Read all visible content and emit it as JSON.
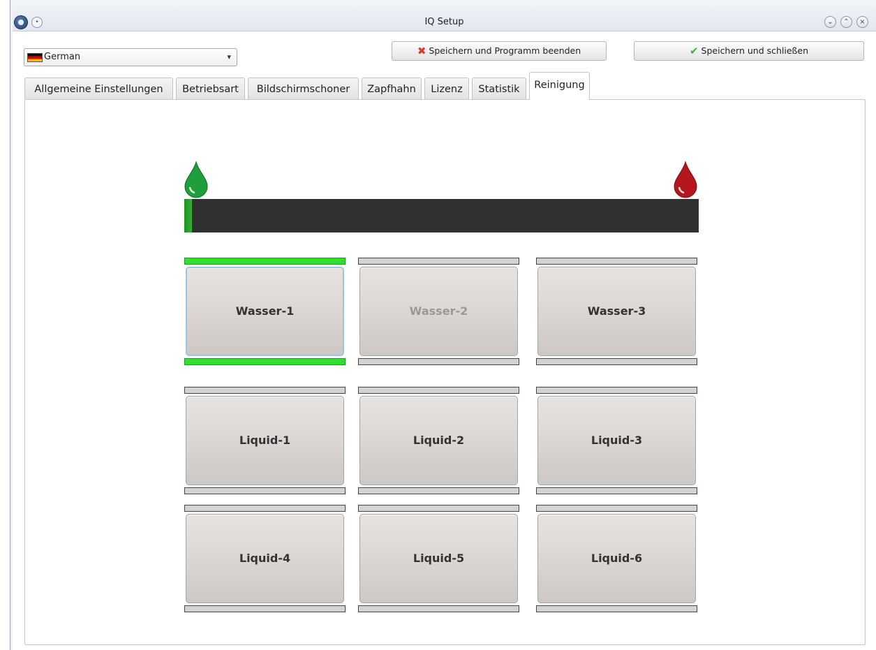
{
  "window": {
    "title": "IQ Setup",
    "buttons": [
      "minimize",
      "maximize",
      "close"
    ]
  },
  "language": {
    "selected": "German",
    "flag": "germany-flag-icon"
  },
  "actions": {
    "quit_label": "Speichern und Programm beenden",
    "quit_icon": "red-x-icon",
    "close_label": "Speichern und schließen",
    "close_icon": "green-check-icon"
  },
  "tabs": [
    {
      "label": "Allgemeine Einstellungen",
      "active": false
    },
    {
      "label": "Betriebsart",
      "active": false
    },
    {
      "label": "Bildschirmschoner",
      "active": false
    },
    {
      "label": "Zapfhahn",
      "active": false
    },
    {
      "label": "Lizenz",
      "active": false
    },
    {
      "label": "Statistik",
      "active": false
    },
    {
      "label": "Reinigung",
      "active": true
    }
  ],
  "cleaning": {
    "progress_fraction": 0.015,
    "colors": {
      "start": "#1f9e3c",
      "end": "#b3161c",
      "track": "#303030",
      "active_bar": "#2ee12e"
    },
    "tiles": [
      {
        "label": "Wasser-1",
        "state": "selected"
      },
      {
        "label": "Wasser-2",
        "state": "disabled"
      },
      {
        "label": "Wasser-3",
        "state": "normal"
      },
      {
        "label": "Liquid-1",
        "state": "normal"
      },
      {
        "label": "Liquid-2",
        "state": "normal"
      },
      {
        "label": "Liquid-3",
        "state": "normal"
      },
      {
        "label": "Liquid-4",
        "state": "normal"
      },
      {
        "label": "Liquid-5",
        "state": "normal"
      },
      {
        "label": "Liquid-6",
        "state": "normal"
      }
    ]
  }
}
